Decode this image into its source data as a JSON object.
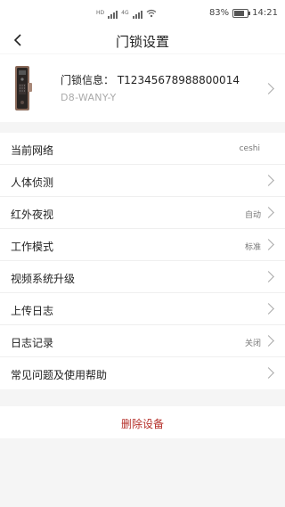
{
  "status_bar": {
    "battery_percent": "83%",
    "time": "14:21",
    "sim1_tag": "HD",
    "sim2_tag": "4G"
  },
  "nav": {
    "title": "门锁设置"
  },
  "device": {
    "info_label": "门锁信息：",
    "serial": "T12345678988800014",
    "model": "D8-WANY-Y"
  },
  "settings": [
    {
      "label": "当前网络",
      "value": "ceshi",
      "chevron": false
    },
    {
      "label": "人体侦测",
      "value": "",
      "chevron": true
    },
    {
      "label": "红外夜视",
      "value": "自动",
      "chevron": true
    },
    {
      "label": "工作模式",
      "value": "标准",
      "chevron": true
    },
    {
      "label": "视频系统升级",
      "value": "",
      "chevron": true
    },
    {
      "label": "上传日志",
      "value": "",
      "chevron": true
    },
    {
      "label": "日志记录",
      "value": "关闭",
      "chevron": true
    },
    {
      "label": "常见问题及使用帮助",
      "value": "",
      "chevron": true
    }
  ],
  "delete": {
    "label": "删除设备",
    "color": "#b5302a"
  }
}
